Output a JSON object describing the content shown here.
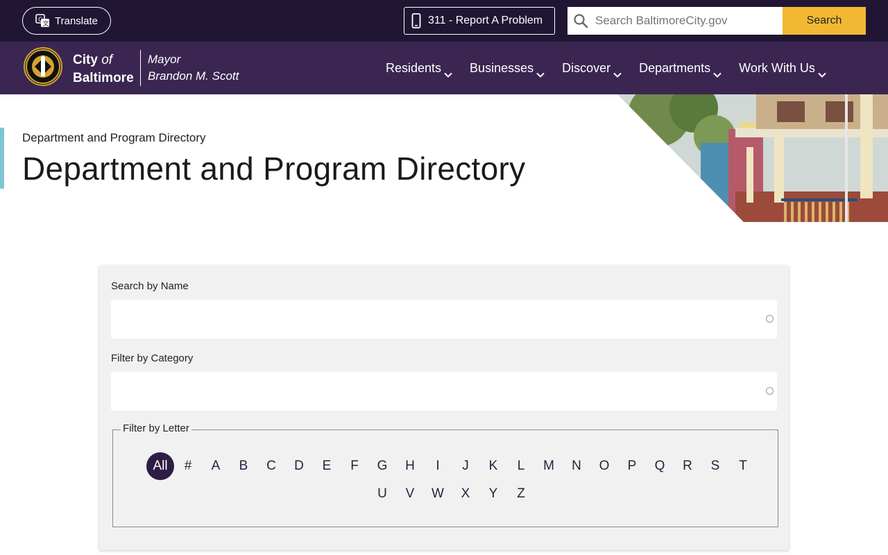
{
  "topbar": {
    "translate_label": "Translate",
    "report_label": "311 - Report A Problem",
    "search_placeholder": "Search BaltimoreCity.gov",
    "search_button": "Search"
  },
  "navbar": {
    "brand_city": "City",
    "brand_of": "of",
    "brand_baltimore": "Baltimore",
    "mayor_title": "Mayor",
    "mayor_name": "Brandon M. Scott",
    "items": [
      "Residents",
      "Businesses",
      "Discover",
      "Departments",
      "Work With Us"
    ]
  },
  "hero": {
    "breadcrumb": "Department and Program Directory",
    "title": "Department and Program Directory"
  },
  "filters": {
    "search_label": "Search by Name",
    "search_value": "",
    "category_label": "Filter by Category",
    "category_value": "",
    "letter_legend": "Filter by Letter",
    "selected_letter": "All",
    "letters": [
      "All",
      "#",
      "A",
      "B",
      "C",
      "D",
      "E",
      "F",
      "G",
      "H",
      "I",
      "J",
      "K",
      "L",
      "M",
      "N",
      "O",
      "P",
      "Q",
      "R",
      "S",
      "T",
      "U",
      "V",
      "W",
      "X",
      "Y",
      "Z"
    ]
  },
  "colors": {
    "topbar_bg": "#201634",
    "navbar_bg": "#3b2652",
    "search_accent": "#f2b833",
    "active_letter_bg": "#2d1d44",
    "hero_accent": "#7fc6d3"
  },
  "icons": {
    "translate": "translate-icon",
    "report": "phone-icon",
    "search": "search-icon",
    "nav_chevron": "chevron-down-icon",
    "seal": "city-seal-logo"
  }
}
